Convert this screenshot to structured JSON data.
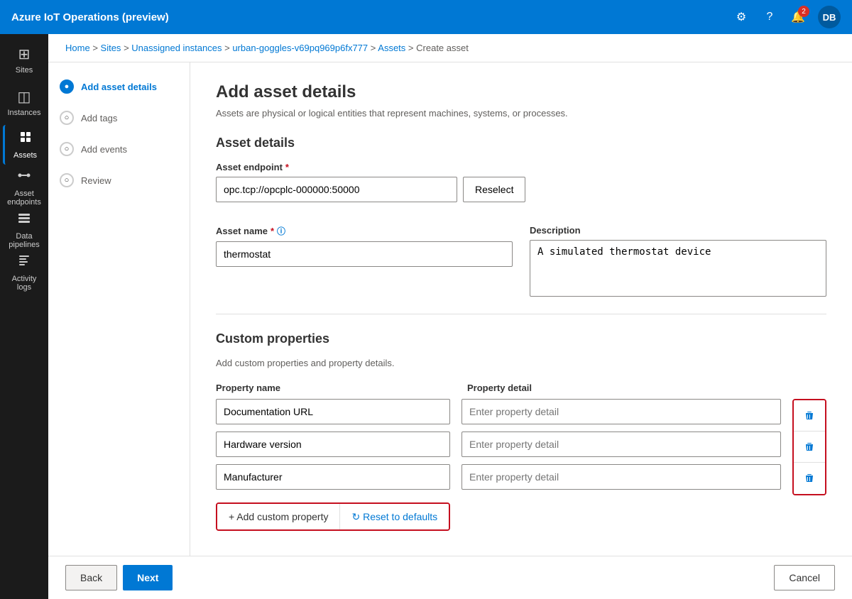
{
  "app": {
    "title": "Azure IoT Operations (preview)"
  },
  "topbar": {
    "title": "Azure IoT Operations (preview)",
    "notification_count": "2",
    "avatar_initials": "DB"
  },
  "breadcrumb": {
    "items": [
      "Home",
      "Sites",
      "Unassigned instances",
      "urban-goggles-v69pq969p6fx777",
      "Assets",
      "Create asset"
    ]
  },
  "sidebar": {
    "items": [
      {
        "id": "sites",
        "label": "Sites",
        "icon": "⊞",
        "active": false
      },
      {
        "id": "instances",
        "label": "Instances",
        "icon": "◫",
        "active": false
      },
      {
        "id": "assets",
        "label": "Assets",
        "icon": "⚙",
        "active": true
      },
      {
        "id": "asset-endpoints",
        "label": "Asset endpoints",
        "icon": "↔",
        "active": false
      },
      {
        "id": "data-pipelines",
        "label": "Data pipelines",
        "icon": "⊟",
        "active": false
      },
      {
        "id": "activity-logs",
        "label": "Activity logs",
        "icon": "📋",
        "active": false
      }
    ]
  },
  "steps": [
    {
      "id": "add-asset-details",
      "label": "Add asset details",
      "active": true,
      "bullet": "●"
    },
    {
      "id": "add-tags",
      "label": "Add tags",
      "active": false,
      "bullet": "○"
    },
    {
      "id": "add-events",
      "label": "Add events",
      "active": false,
      "bullet": "○"
    },
    {
      "id": "review",
      "label": "Review",
      "active": false,
      "bullet": "○"
    }
  ],
  "form": {
    "page_title": "Add asset details",
    "page_subtitle": "Assets are physical or logical entities that represent machines, systems, or processes.",
    "asset_details_title": "Asset details",
    "asset_endpoint_label": "Asset endpoint",
    "asset_endpoint_value": "opc.tcp://opcplc-000000:50000",
    "reselect_label": "Reselect",
    "asset_name_label": "Asset name",
    "asset_name_value": "thermostat",
    "asset_name_placeholder": "",
    "description_label": "Description",
    "description_value": "A simulated thermostat device",
    "description_placeholder": "",
    "custom_properties_title": "Custom properties",
    "custom_properties_desc": "Add custom properties and property details.",
    "prop_name_header": "Property name",
    "prop_detail_header": "Property detail",
    "properties": [
      {
        "name": "Documentation URL",
        "detail": "",
        "detail_placeholder": "Enter property detail"
      },
      {
        "name": "Hardware version",
        "detail": "",
        "detail_placeholder": "Enter property detail"
      },
      {
        "name": "Manufacturer",
        "detail": "",
        "detail_placeholder": "Enter property detail"
      }
    ],
    "add_custom_label": "+ Add custom property",
    "reset_defaults_label": "↻ Reset to defaults"
  },
  "footer": {
    "back_label": "Back",
    "next_label": "Next",
    "cancel_label": "Cancel"
  }
}
